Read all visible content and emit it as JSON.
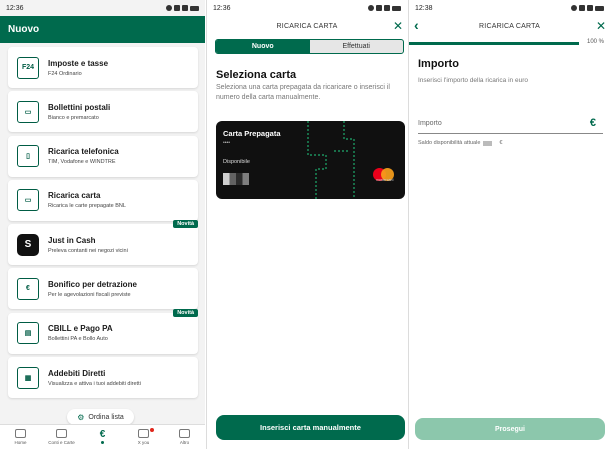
{
  "screens": [
    {
      "status_time": "12:36",
      "header_title": "Nuovo",
      "items": [
        {
          "title": "Imposte e tasse",
          "subtitle": "F24 Ordinario",
          "icon": "F24",
          "badge": ""
        },
        {
          "title": "Bollettini postali",
          "subtitle": "Bianco e premarcato",
          "icon": "",
          "badge": ""
        },
        {
          "title": "Ricarica telefonica",
          "subtitle": "TIM, Vodafone e WINDTRE",
          "icon": "",
          "badge": ""
        },
        {
          "title": "Ricarica carta",
          "subtitle": "Ricarica le carte prepagate BNL",
          "icon": "",
          "badge": ""
        },
        {
          "title": "Just in Cash",
          "subtitle": "Preleva contanti nei negozi vicini",
          "icon": "S",
          "badge": "Novità"
        },
        {
          "title": "Bonifico per detrazione",
          "subtitle": "Per le agevolazioni fiscali previste",
          "icon": "€",
          "badge": ""
        },
        {
          "title": "CBILL e Pago PA",
          "subtitle": "Bollettini PA e Bollo Auto",
          "icon": "",
          "badge": "Novità"
        },
        {
          "title": "Addebiti Diretti",
          "subtitle": "Visualizza e attiva i tuoi addebiti diretti",
          "icon": "",
          "badge": ""
        }
      ],
      "sort_label": "Ordina lista",
      "nav": [
        {
          "label": "Home",
          "glyph": ""
        },
        {
          "label": "Conti e Carte",
          "glyph": ""
        },
        {
          "label": "",
          "glyph": "€"
        },
        {
          "label": "X you",
          "glyph": ""
        },
        {
          "label": "Altro",
          "glyph": ""
        }
      ]
    },
    {
      "status_time": "12:36",
      "title": "RICARICA CARTA",
      "tabs": [
        "Nuovo",
        "Effettuati"
      ],
      "heading": "Seleziona carta",
      "description": "Seleziona una carta prepagata da ricaricare o inserisci il numero della carta manualmente.",
      "card": {
        "name": "Carta Prepagata",
        "number": "•••• ",
        "available_label": "Disponibile",
        "brand": "mastercard"
      },
      "button_label": "Inserisci carta manualmente"
    },
    {
      "status_time": "12:38",
      "title": "RICARICA CARTA",
      "progress_label": "100 %",
      "progress_value": 100,
      "heading": "Importo",
      "description": "Inserisci l'importo della ricarica in euro",
      "field_label": "Importo",
      "currency_icon": "€",
      "saldo_label": "Saldo disponibilità attuale",
      "saldo_currency": "€",
      "button_label": "Prosegui"
    }
  ],
  "colors": {
    "brand_green": "#006a4d",
    "disabled_green": "#8cc7ac",
    "mastercard_red": "#eb001b",
    "mastercard_yellow": "#f79e1b"
  }
}
